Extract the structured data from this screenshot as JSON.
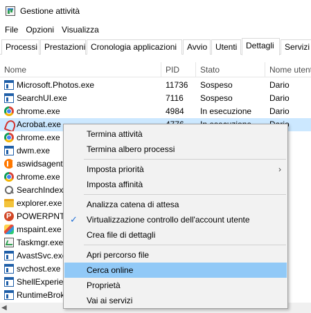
{
  "window": {
    "title": "Gestione attività"
  },
  "menu": [
    "File",
    "Opzioni",
    "Visualizza"
  ],
  "tabs": [
    {
      "label": "Processi",
      "active": false
    },
    {
      "label": "Prestazioni",
      "active": false
    },
    {
      "label": "Cronologia applicazioni",
      "active": false
    },
    {
      "label": "Avvio",
      "active": false
    },
    {
      "label": "Utenti",
      "active": false
    },
    {
      "label": "Dettagli",
      "active": true
    },
    {
      "label": "Servizi",
      "active": false
    }
  ],
  "columns": {
    "name": "Nome",
    "pid": "PID",
    "state": "Stato",
    "user": "Nome utente"
  },
  "rows": [
    {
      "icon": "window-icon",
      "name": "Microsoft.Photos.exe",
      "pid": "11736",
      "state": "Sospeso",
      "user": "Dario"
    },
    {
      "icon": "window-icon",
      "name": "SearchUI.exe",
      "pid": "7116",
      "state": "Sospeso",
      "user": "Dario"
    },
    {
      "icon": "chrome-icon",
      "name": "chrome.exe",
      "pid": "4984",
      "state": "In esecuzione",
      "user": "Dario"
    },
    {
      "icon": "acrobat-icon",
      "name": "Acrobat.exe",
      "pid": "4776",
      "state": "In esecuzione",
      "user": "Dario",
      "selected": true
    },
    {
      "icon": "chrome-icon",
      "name": "chrome.exe",
      "pid": "",
      "state": "",
      "user": ""
    },
    {
      "icon": "window-icon",
      "name": "dwm.exe",
      "pid": "",
      "state": "",
      "user": "M-7"
    },
    {
      "icon": "avast-icon",
      "name": "aswidsagent",
      "pid": "",
      "state": "",
      "user": "EM"
    },
    {
      "icon": "chrome-icon",
      "name": "chrome.exe",
      "pid": "",
      "state": "",
      "user": ""
    },
    {
      "icon": "search-indexer-icon",
      "name": "SearchIndexe",
      "pid": "",
      "state": "",
      "user": "EM"
    },
    {
      "icon": "folder-icon",
      "name": "explorer.exe",
      "pid": "",
      "state": "",
      "user": ""
    },
    {
      "icon": "powerpoint-icon",
      "name": "POWERPNT.",
      "pid": "",
      "state": "",
      "user": ""
    },
    {
      "icon": "paint-icon",
      "name": "mspaint.exe",
      "pid": "",
      "state": "",
      "user": ""
    },
    {
      "icon": "taskmgr-icon",
      "name": "Taskmgr.exe",
      "pid": "",
      "state": "",
      "user": ""
    },
    {
      "icon": "window-icon",
      "name": "AvastSvc.exe",
      "pid": "",
      "state": "",
      "user": "EM"
    },
    {
      "icon": "window-icon",
      "name": "svchost.exe",
      "pid": "",
      "state": "",
      "user": "EM"
    },
    {
      "icon": "window-icon",
      "name": "ShellExperien",
      "pid": "",
      "state": "",
      "user": ""
    },
    {
      "icon": "window-icon",
      "name": "RuntimeBrok",
      "pid": "",
      "state": "",
      "user": ""
    }
  ],
  "context_menu": {
    "items": [
      {
        "label": "Termina attività"
      },
      {
        "label": "Termina albero processi"
      },
      {
        "separator": true
      },
      {
        "label": "Imposta priorità",
        "submenu": true
      },
      {
        "label": "Imposta affinità"
      },
      {
        "separator": true
      },
      {
        "label": "Analizza catena di attesa"
      },
      {
        "label": "Virtualizzazione controllo dell'account utente",
        "checked": true
      },
      {
        "label": "Crea file di dettagli"
      },
      {
        "separator": true
      },
      {
        "label": "Apri percorso file"
      },
      {
        "label": "Cerca online",
        "highlighted": true
      },
      {
        "label": "Proprietà"
      },
      {
        "label": "Vai ai servizi"
      }
    ],
    "submenu_glyph": "›",
    "check_glyph": "✓"
  },
  "scrollbar": {
    "left_glyph": "◀"
  },
  "colors": {
    "selection": "#cce8ff",
    "menu_highlight": "#91c9f7",
    "check": "#1f6fd6"
  }
}
